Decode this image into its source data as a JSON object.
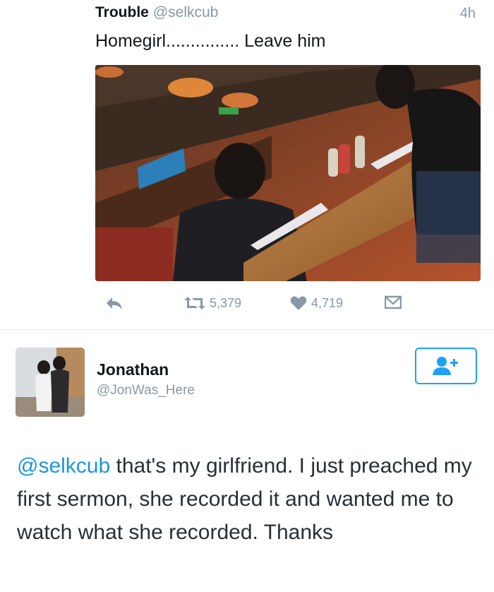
{
  "tweet1": {
    "name": "Trouble",
    "handle": "@selkcub",
    "time": "4h",
    "text": "Homegirl............... Leave him",
    "actions": {
      "reply_icon": "reply-icon",
      "retweet_icon": "retweet-icon",
      "retweets": "5,379",
      "like_icon": "heart-icon",
      "likes": "4,719",
      "dm_icon": "direct-message-icon"
    }
  },
  "tweet2": {
    "name": "Jonathan",
    "handle": "@JonWas_Here",
    "follow_icon": "add-user-icon",
    "mention": "@selkcub",
    "text": " that's my girlfriend. I just preached my first sermon, she recorded it and wanted me to watch what she recorded. Thanks"
  },
  "colors": {
    "link": "#1b95e0",
    "muted": "#8899a6",
    "follow_border": "#1da1f2"
  }
}
